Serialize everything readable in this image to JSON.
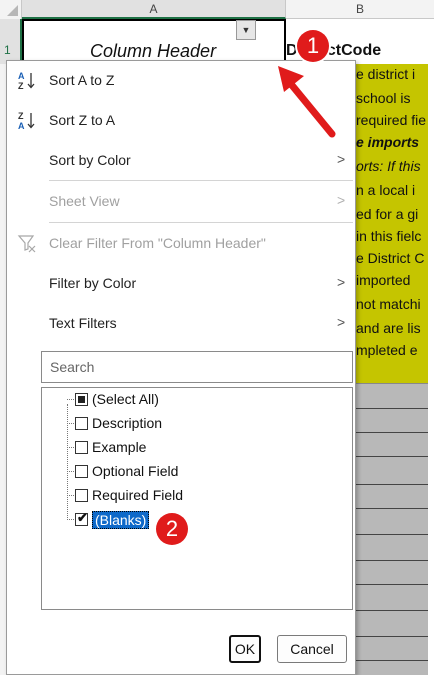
{
  "sheet": {
    "column_a": "A",
    "column_b": "B",
    "row_1": "1",
    "a1_value": "Column Header",
    "b1_value": "DistrictCode",
    "filter_button_glyph": "▼",
    "b_column_lines": [
      "e district i",
      "school is",
      "required fie",
      "e imports",
      "orts: If this",
      "n a local i",
      "ed for a gi",
      "in this fielc",
      "e District C",
      "imported",
      "not matchi",
      "and are lis",
      "mpleted e"
    ],
    "cell_fill_color": "#c5c500"
  },
  "menu": {
    "sort_az": "Sort A to Z",
    "sort_za": "Sort Z to A",
    "sort_by_color": "Sort by Color",
    "sheet_view": "Sheet View",
    "clear_filter": "Clear Filter From \"Column Header\"",
    "filter_by_color": "Filter by Color",
    "text_filters": "Text Filters",
    "chevron": ">"
  },
  "search": {
    "placeholder": "Search"
  },
  "filter_list": [
    {
      "label": "(Select All)",
      "state": "indeterminate"
    },
    {
      "label": "Description",
      "state": "unchecked"
    },
    {
      "label": "Example",
      "state": "unchecked"
    },
    {
      "label": "Optional Field",
      "state": "unchecked"
    },
    {
      "label": "Required Field",
      "state": "unchecked"
    },
    {
      "label": "(Blanks)",
      "state": "checked"
    }
  ],
  "buttons": {
    "ok": "OK",
    "cancel": "Cancel"
  },
  "annotations": {
    "step1": "1",
    "step2": "2",
    "color": "#e01b1b"
  }
}
